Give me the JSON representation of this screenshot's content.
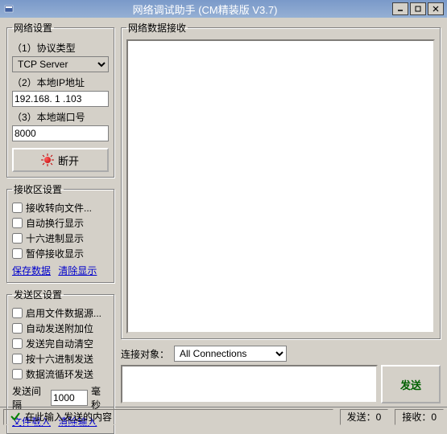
{
  "window": {
    "title": "网络调试助手 (CM精装版 V3.7)"
  },
  "netSettings": {
    "legend": "网络设置",
    "protocolLabel": "（1）协议类型",
    "protocolValue": "TCP Server",
    "ipLabel": "（2）本地IP地址",
    "ipValue": "192.168. 1 .103",
    "portLabel": "（3）本地端口号",
    "portValue": "8000",
    "disconnectLabel": "断开"
  },
  "recvSettings": {
    "legend": "接收区设置",
    "toFile": "接收转向文件...",
    "autoWrap": "自动换行显示",
    "hex": "十六进制显示",
    "pause": "暂停接收显示",
    "saveLink": "保存数据",
    "clearLink": "清除显示"
  },
  "sendSettings": {
    "legend": "发送区设置",
    "fileSource": "启用文件数据源...",
    "autoExtra": "自动发送附加位",
    "autoClear": "发送完自动清空",
    "hexSend": "按十六进制发送",
    "loopSend": "数据流循环发送",
    "intervalLabel": "发送间隔",
    "intervalValue": "1000",
    "intervalUnit": "毫秒",
    "fileLoadLink": "文件载入",
    "clearInputLink": "清除输入"
  },
  "recvArea": {
    "legend": "网络数据接收"
  },
  "connRow": {
    "label": "连接对象：",
    "value": "All Connections"
  },
  "sendRow": {
    "sendLabel": "发送"
  },
  "status": {
    "readyText": "在此输入发送的内容",
    "sendCount": "发送：0",
    "recvCount": "接收：0"
  }
}
